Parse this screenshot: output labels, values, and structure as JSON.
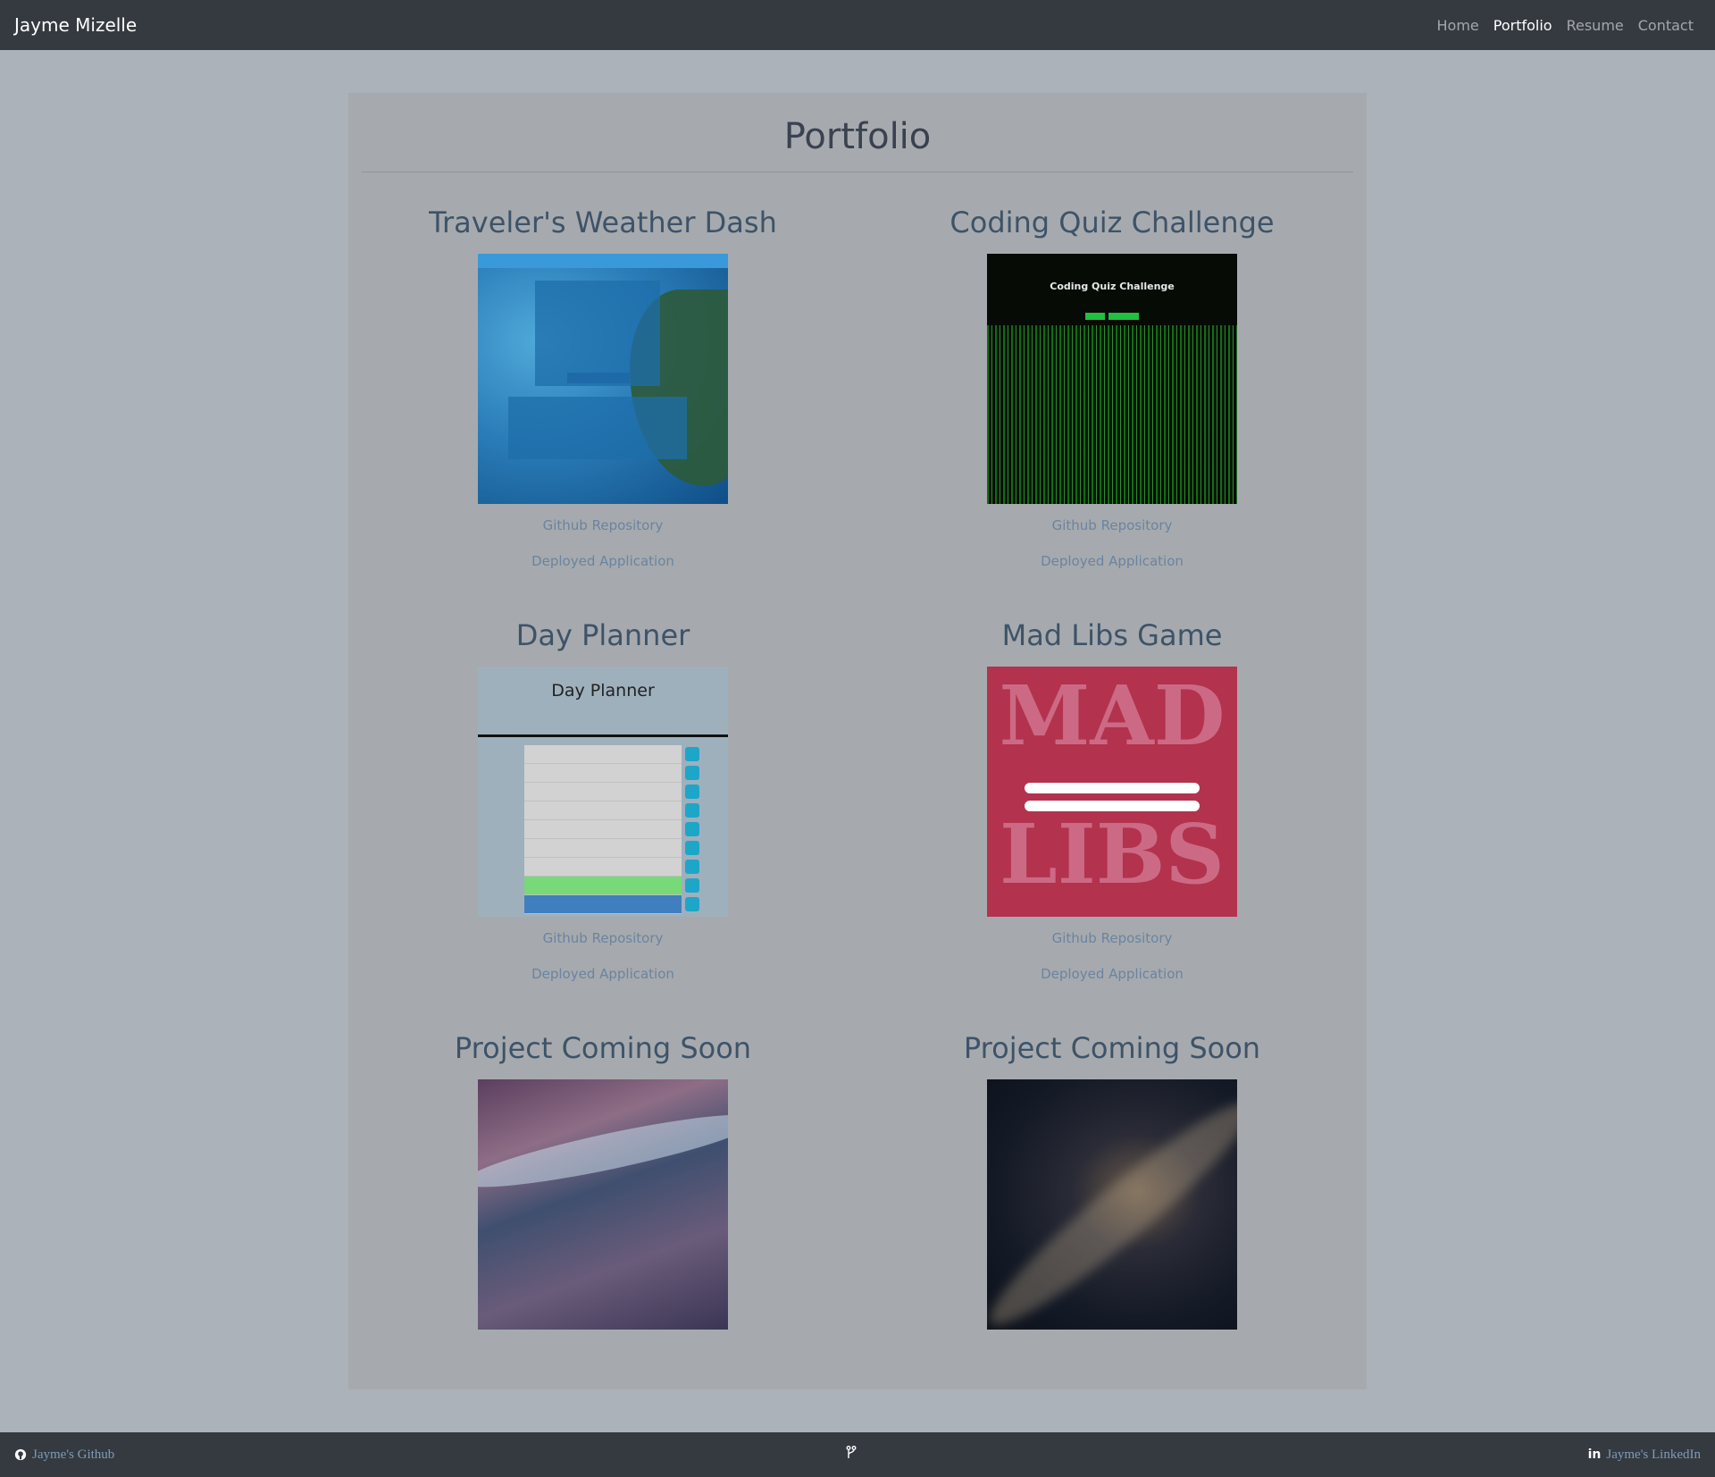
{
  "navbar": {
    "brand": "Jayme Mizelle",
    "links": [
      {
        "label": "Home",
        "active": false
      },
      {
        "label": "Portfolio",
        "active": true
      },
      {
        "label": "Resume",
        "active": false
      },
      {
        "label": "Contact",
        "active": false
      }
    ]
  },
  "main": {
    "title": "Portfolio",
    "projects": [
      {
        "title": "Traveler's Weather Dash",
        "repo_label": "Github Repository",
        "app_label": "Deployed Application"
      },
      {
        "title": "Coding Quiz Challenge",
        "repo_label": "Github Repository",
        "app_label": "Deployed Application",
        "thumb_text": "Coding Quiz Challenge"
      },
      {
        "title": "Day Planner",
        "repo_label": "Github Repository",
        "app_label": "Deployed Application",
        "thumb_text": "Day Planner"
      },
      {
        "title": "Mad Libs Game",
        "repo_label": "Github Repository",
        "app_label": "Deployed Application",
        "thumb_text_1": "MAD",
        "thumb_text_2": "LIBS"
      },
      {
        "title": "Project Coming Soon"
      },
      {
        "title": "Project Coming Soon"
      }
    ]
  },
  "footer": {
    "github_label": "Jayme's Github",
    "center_icon": "fork-icon",
    "linkedin_label": "Jayme's LinkedIn",
    "linkedin_icon_text": "in"
  },
  "colors": {
    "navbar_bg": "#343a40",
    "page_bg": "#abb2b9",
    "card_bg": "#a6aaae",
    "project_title": "#3e5368",
    "link": "#6b83a0"
  }
}
